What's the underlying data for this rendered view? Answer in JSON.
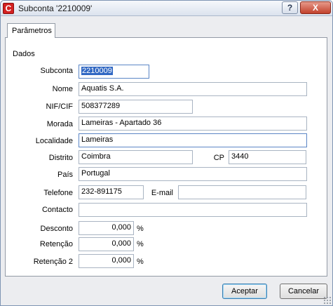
{
  "window": {
    "title": "Subconta '2210009'",
    "app_icon_glyph": "C",
    "help_glyph": "?",
    "close_glyph": "X"
  },
  "tab": {
    "label": "Parâmetros"
  },
  "group": {
    "label": "Dados"
  },
  "form": {
    "subconta_label": "Subconta",
    "subconta_value": "2210009",
    "nome_label": "Nome",
    "nome_value": "Aquatis S.A.",
    "nif_label": "NIF/CIF",
    "nif_value": "508377289",
    "morada_label": "Morada",
    "morada_value": "Lameiras - Apartado 36",
    "localidade_label": "Localidade",
    "localidade_value": "Lameiras",
    "distrito_label": "Distrito",
    "distrito_value": "Coimbra",
    "cp_label": "CP",
    "cp_value": "3440",
    "pais_label": "País",
    "pais_value": "Portugal",
    "telefone_label": "Telefone",
    "telefone_value": "232-891175",
    "email_label": "E-mail",
    "email_value": "",
    "contacto_label": "Contacto",
    "contacto_value": "",
    "desconto_label": "Desconto",
    "desconto_value": "0,000",
    "retencao_label": "Retenção",
    "retencao_value": "0,000",
    "retencao2_label": "Retenção 2",
    "retencao2_value": "0,000",
    "percent_symbol": "%"
  },
  "buttons": {
    "ok": "Aceptar",
    "cancel": "Cancelar"
  },
  "colors": {
    "accent": "#3168c3",
    "close": "#c2412c",
    "app_icon": "#d32020"
  },
  "icons": [
    "app-icon",
    "help-icon",
    "close-icon",
    "resize-grip-icon"
  ]
}
